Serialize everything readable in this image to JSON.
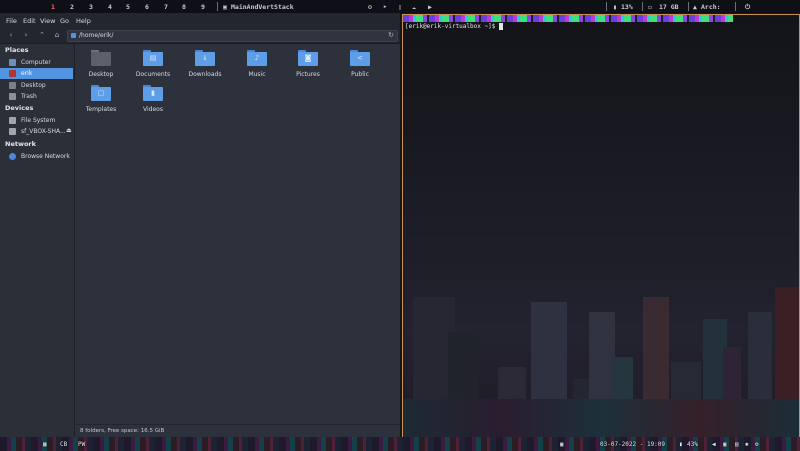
{
  "topbar": {
    "workspaces": [
      "1",
      "2",
      "3",
      "4",
      "5",
      "6",
      "7",
      "8",
      "9"
    ],
    "active_workspace": "1",
    "layout_name": "MainAndVertStack",
    "cpu": "13%",
    "memory": "17 GB",
    "os": "Arch:",
    "colors": {
      "active": "#ff6b6b",
      "bg": "#0e1016"
    }
  },
  "filemanager": {
    "menu": [
      "File",
      "Edit",
      "View",
      "Go",
      "Help"
    ],
    "path": "/home/erik/",
    "sidebar": {
      "places_title": "Places",
      "places": [
        "Computer",
        "erik",
        "Desktop",
        "Trash"
      ],
      "devices_title": "Devices",
      "devices": [
        "File System",
        "sf_VBOX-SHA..."
      ],
      "network_title": "Network",
      "network": [
        "Browse Network"
      ]
    },
    "folders": [
      {
        "name": "Desktop",
        "icon": "desktop-folder-icon"
      },
      {
        "name": "Documents",
        "icon": "documents-folder-icon"
      },
      {
        "name": "Downloads",
        "icon": "downloads-folder-icon"
      },
      {
        "name": "Music",
        "icon": "music-folder-icon"
      },
      {
        "name": "Pictures",
        "icon": "pictures-folder-icon"
      },
      {
        "name": "Public",
        "icon": "public-folder-icon"
      },
      {
        "name": "Templates",
        "icon": "templates-folder-icon"
      },
      {
        "name": "Videos",
        "icon": "videos-folder-icon"
      }
    ],
    "status": "8 folders, Free space: 16.5 GiB",
    "colors": {
      "accent": "#5294e2",
      "folder": "#5e9ee8"
    }
  },
  "terminal": {
    "prompt": "[erik@erik-virtualbox ~]$ "
  },
  "bottombar": {
    "left": [
      "CB",
      "PW"
    ],
    "datetime": "03-07-2022 - 19:09",
    "battery": "43%"
  }
}
